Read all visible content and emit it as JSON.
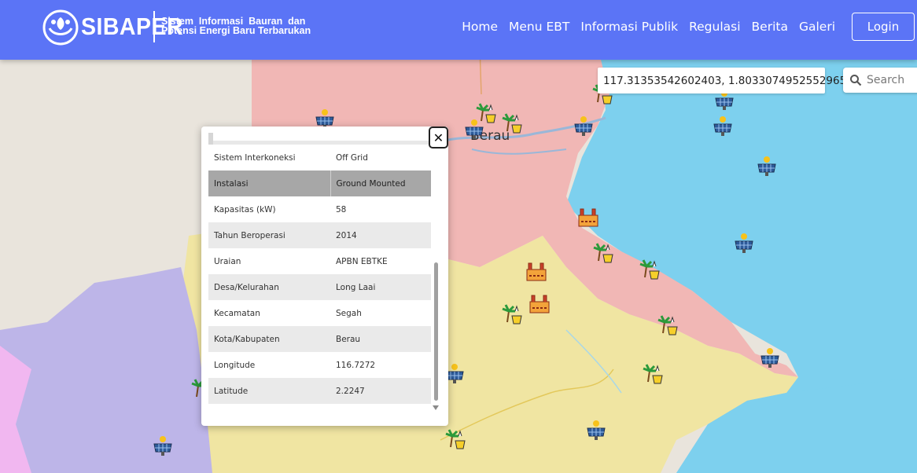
{
  "header": {
    "brand_name": "SIBAPER",
    "tagline_line1": "Sistem  Informasi  Bauran  dan",
    "tagline_line2": "Potensi Energi Baru Terbarukan",
    "nav": [
      "Home",
      "Menu EBT",
      "Informasi Publik",
      "Regulasi",
      "Berita",
      "Galeri"
    ],
    "login_label": "Login"
  },
  "map": {
    "coordinate_readout": "117.31353542602403, 1.8033074952552965",
    "search_placeholder": "Search",
    "town_label": "Berau",
    "marker_icons": [
      "solar-panel-icon",
      "palm-oil-plant-icon",
      "hydro-plant-icon"
    ]
  },
  "popup": {
    "close_label": "✕",
    "rows": [
      {
        "key": "Sistem Interkoneksi",
        "value": "Off Grid",
        "highlight": false
      },
      {
        "key": "Instalasi",
        "value": "Ground Mounted",
        "highlight": true
      },
      {
        "key": "Kapasitas (kW)",
        "value": "58",
        "highlight": false
      },
      {
        "key": "Tahun Beroperasi",
        "value": "2014",
        "highlight": false
      },
      {
        "key": "Uraian",
        "value": "APBN EBTKE",
        "highlight": false
      },
      {
        "key": "Desa/Kelurahan",
        "value": "Long Laai",
        "highlight": false
      },
      {
        "key": "Kecamatan",
        "value": "Segah",
        "highlight": false
      },
      {
        "key": "Kota/Kabupaten",
        "value": "Berau",
        "highlight": false
      },
      {
        "key": "Longitude",
        "value": "116.7272",
        "highlight": false
      },
      {
        "key": "Latitude",
        "value": "2.2247",
        "highlight": false
      }
    ]
  },
  "colors": {
    "header_bg": "#5b74f6",
    "sea": "#7dd0ee",
    "region_pink": "#f1b7b5",
    "region_yellow": "#f0e5a2",
    "region_purple": "#bdb5e8",
    "land_grey": "#e9e4dc"
  }
}
